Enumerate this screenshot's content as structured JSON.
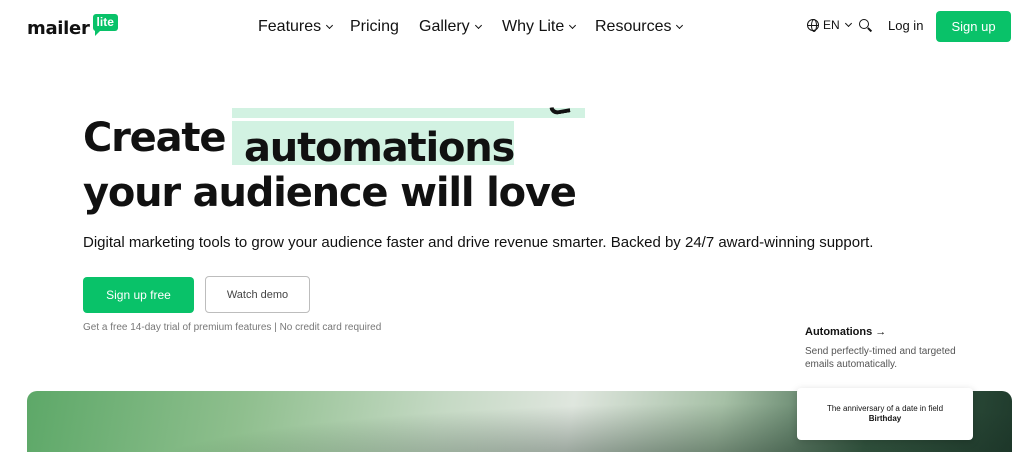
{
  "header": {
    "logo_text": "mailer",
    "logo_badge": "lite",
    "nav": [
      {
        "label": "Features",
        "has_dropdown": true
      },
      {
        "label": "Pricing",
        "has_dropdown": false
      },
      {
        "label": "Gallery",
        "has_dropdown": true
      },
      {
        "label": "Why Lite",
        "has_dropdown": true
      },
      {
        "label": "Resources",
        "has_dropdown": true
      }
    ],
    "language": "EN",
    "login_label": "Log in",
    "signup_label": "Sign up"
  },
  "hero": {
    "headline_word1": "Create",
    "headline_highlight": "automations",
    "headline_line2": "your audience will love",
    "subtitle": "Digital marketing tools to grow your audience faster and drive revenue smarter. Backed by 24/7 award-winning support.",
    "primary_cta": "Sign up free",
    "secondary_cta": "Watch demo",
    "trial_note": "Get a free 14-day trial of premium features | No credit card required"
  },
  "feature": {
    "title": "Automations →",
    "description": "Send perfectly-timed and targeted emails automatically."
  },
  "card": {
    "text": "The anniversary of a date in field",
    "field": "Birthday"
  },
  "colors": {
    "brand_green": "#09c269",
    "highlight": "#d2f2e2",
    "text": "#111111"
  }
}
